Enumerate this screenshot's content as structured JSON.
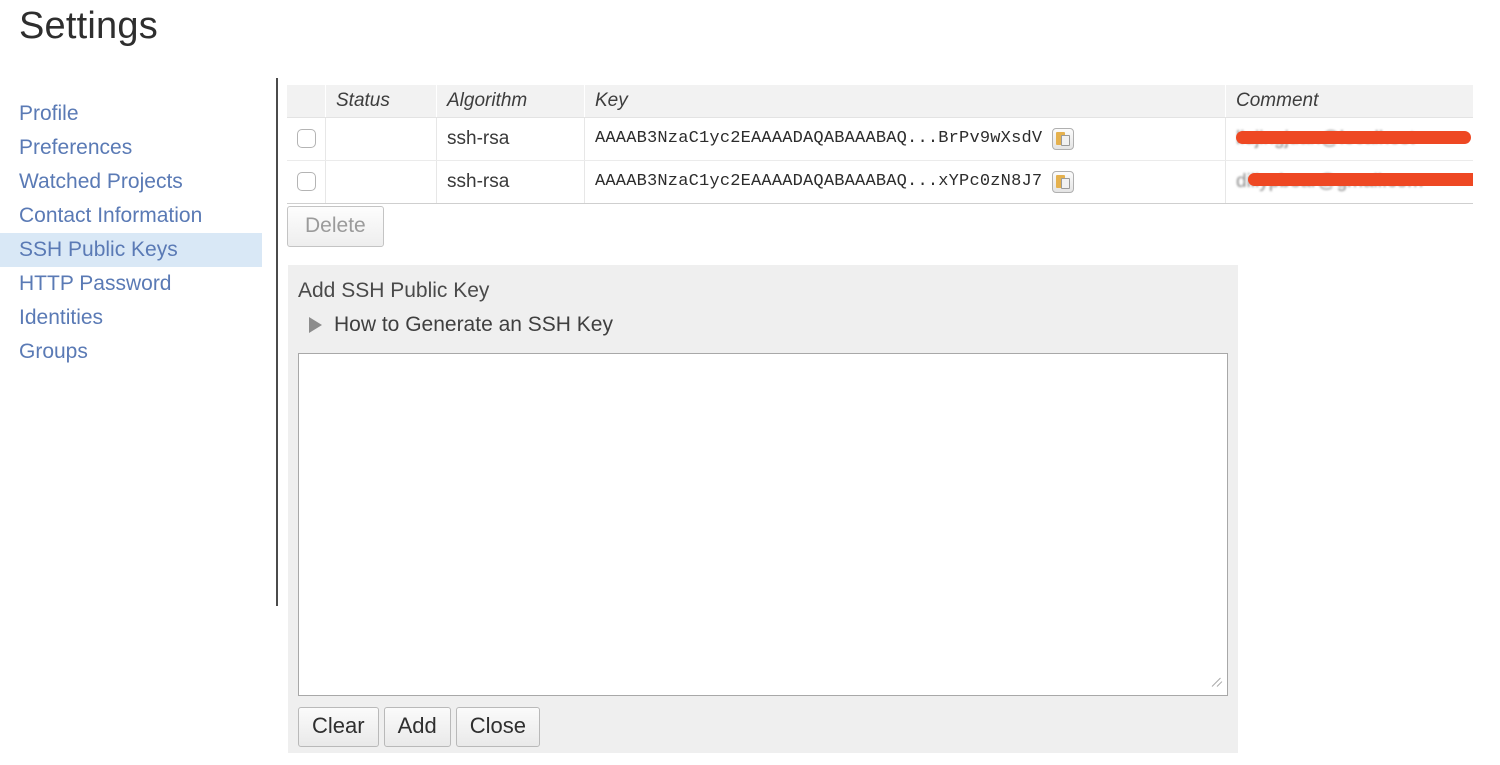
{
  "page": {
    "title": "Settings"
  },
  "sidebar": {
    "items": [
      {
        "label": "Profile",
        "active": false
      },
      {
        "label": "Preferences",
        "active": false
      },
      {
        "label": "Watched Projects",
        "active": false
      },
      {
        "label": "Contact Information",
        "active": false
      },
      {
        "label": "SSH Public Keys",
        "active": true
      },
      {
        "label": "HTTP Password",
        "active": false
      },
      {
        "label": "Identities",
        "active": false
      },
      {
        "label": "Groups",
        "active": false
      }
    ],
    "active_highlight_color": "#d9e8f6",
    "link_color": "#5a7ab5"
  },
  "keys_table": {
    "columns": [
      "",
      "Status",
      "Algorithm",
      "Key",
      "Comment"
    ],
    "rows": [
      {
        "checked": false,
        "status": "",
        "algorithm": "ssh-rsa",
        "key": "AAAAB3NzaC1yc2EAAAADAQABAAABAQ...BrPv9wXsdV",
        "copy_icon": "copy-clipboard-icon",
        "comment": "",
        "comment_redacted": true
      },
      {
        "checked": false,
        "status": "",
        "algorithm": "ssh-rsa",
        "key": "AAAAB3NzaC1yc2EAAAADAQABAAABAQ...xYPc0zN8J7",
        "copy_icon": "copy-clipboard-icon",
        "comment": "",
        "comment_redacted": true
      }
    ],
    "header_bg": "#f2f2f2",
    "redaction_color": "#ee4823"
  },
  "actions": {
    "delete_label": "Delete"
  },
  "add_panel": {
    "title": "Add SSH Public Key",
    "disclosure_label": "How to Generate an SSH Key",
    "disclosure_icon": "triangle-right-icon",
    "textarea_value": "",
    "textarea_placeholder": "",
    "buttons": [
      {
        "label": "Clear"
      },
      {
        "label": "Add"
      },
      {
        "label": "Close"
      }
    ],
    "panel_bg": "#efefef"
  }
}
